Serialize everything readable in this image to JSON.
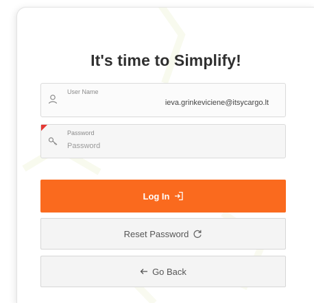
{
  "login": {
    "title": "It's time to Simplify!",
    "username": {
      "label": "User Name",
      "value": "ieva.grinkeviciene@itsycargo.lt",
      "icon": "user-icon"
    },
    "password": {
      "label": "Password",
      "placeholder": "Password",
      "icon": "key-icon",
      "required": true
    },
    "buttons": {
      "login_label": "Log In",
      "login_icon": "sign-in-icon",
      "reset_label": "Reset Password",
      "reset_icon": "refresh-icon",
      "back_label": "Go Back",
      "back_icon": "arrow-left-icon"
    }
  },
  "colors": {
    "accent": "#fa6a1e",
    "required_marker": "#e53935"
  }
}
